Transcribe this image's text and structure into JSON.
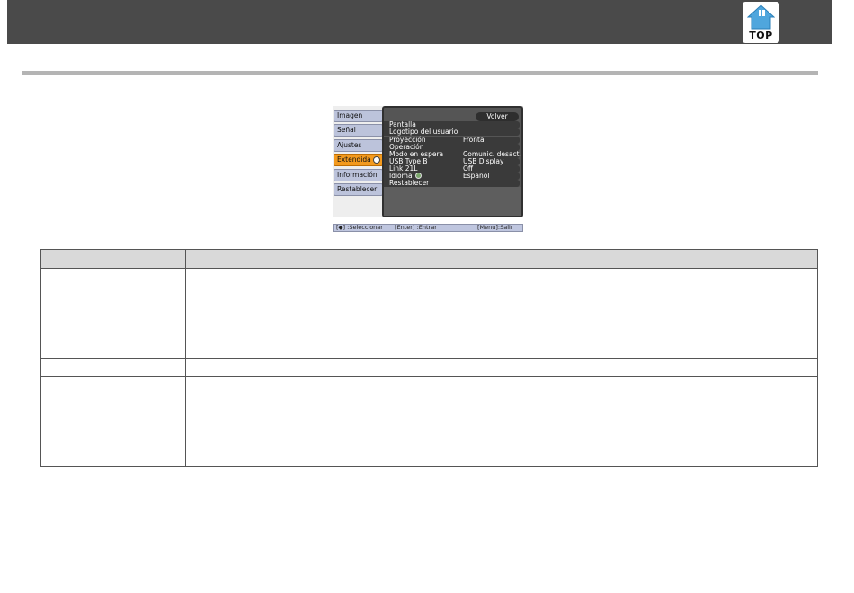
{
  "header": {
    "top_button_label": "TOP"
  },
  "osd": {
    "tabs": [
      {
        "label": "Imagen",
        "active": false
      },
      {
        "label": "Señal",
        "active": false
      },
      {
        "label": "Ajustes",
        "active": false
      },
      {
        "label": "Extendida",
        "active": true
      },
      {
        "label": "Información",
        "active": false
      },
      {
        "label": "Restablecer",
        "active": false
      }
    ],
    "back_label": "Volver",
    "items": [
      {
        "label": "Pantalla",
        "value": ""
      },
      {
        "label": "Logotipo del usuario",
        "value": ""
      },
      {
        "label": "Proyección",
        "value": "Frontal"
      },
      {
        "label": "Operación",
        "value": ""
      },
      {
        "label": "Modo en espera",
        "value": "Comunic. desact."
      },
      {
        "label": "USB Type B",
        "value": "USB Display"
      },
      {
        "label": "Link 21L",
        "value": "Off"
      },
      {
        "label": "Idioma",
        "value": "Español",
        "icon": "globe-icon"
      },
      {
        "label": "Restablecer",
        "value": ""
      }
    ],
    "footer": {
      "select": "[◆] :Seleccionar",
      "enter": "[Enter] :Entrar",
      "exit": "[Menu]:Salir"
    }
  },
  "table": {
    "headers": [
      "",
      ""
    ],
    "rows": [
      [
        "",
        ""
      ],
      [
        "",
        ""
      ],
      [
        "",
        ""
      ]
    ]
  },
  "colors": {
    "header_bg": "#4a4a4a",
    "active_tab": "#f39a1e",
    "tab_bg": "#bcc3db",
    "panel_bg": "#555555"
  }
}
